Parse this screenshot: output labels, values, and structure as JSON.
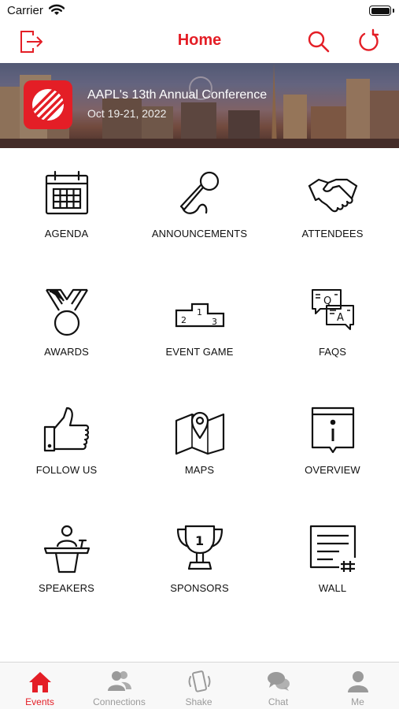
{
  "status_bar": {
    "carrier": "Carrier"
  },
  "nav": {
    "title": "Home"
  },
  "banner": {
    "conference_title": "AAPL's 13th Annual Conference",
    "dates": "Oct 19-21, 2022"
  },
  "tiles": [
    {
      "label": "AGENDA",
      "icon": "calendar-icon"
    },
    {
      "label": "ANNOUNCEMENTS",
      "icon": "microphone-icon"
    },
    {
      "label": "ATTENDEES",
      "icon": "handshake-icon"
    },
    {
      "label": "AWARDS",
      "icon": "medal-icon"
    },
    {
      "label": "EVENT GAME",
      "icon": "podium-icon"
    },
    {
      "label": "FAQS",
      "icon": "faq-bubbles-icon"
    },
    {
      "label": "FOLLOW US",
      "icon": "thumbs-up-icon"
    },
    {
      "label": "MAPS",
      "icon": "map-pin-icon"
    },
    {
      "label": "OVERVIEW",
      "icon": "info-icon"
    },
    {
      "label": "SPEAKERS",
      "icon": "speaker-lectern-icon"
    },
    {
      "label": "SPONSORS",
      "icon": "trophy-icon"
    },
    {
      "label": "WALL",
      "icon": "wall-post-icon"
    }
  ],
  "podium_numbers": [
    "1",
    "2",
    "3"
  ],
  "faq_letters": [
    "Q",
    "A"
  ],
  "trophy_number": "1",
  "tabs": [
    {
      "label": "Events",
      "icon": "home-icon",
      "active": true
    },
    {
      "label": "Connections",
      "icon": "people-icon",
      "active": false
    },
    {
      "label": "Shake",
      "icon": "shake-phone-icon",
      "active": false
    },
    {
      "label": "Chat",
      "icon": "chat-bubbles-icon",
      "active": false
    },
    {
      "label": "Me",
      "icon": "person-icon",
      "active": false
    }
  ],
  "colors": {
    "accent": "#e41e26",
    "inactive": "#9a9a9a",
    "icon_stroke": "#111111"
  }
}
